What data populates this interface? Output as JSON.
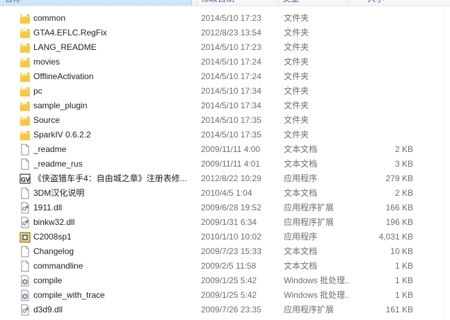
{
  "header": {
    "name": "名称",
    "date": "修改日期",
    "type": "类型",
    "size": "大小"
  },
  "files": [
    {
      "name": "common",
      "date": "2014/5/10 17:23",
      "type": "文件夹",
      "size": "",
      "icon": "folder-icon"
    },
    {
      "name": "GTA4.EFLC.RegFix",
      "date": "2012/8/23 13:54",
      "type": "文件夹",
      "size": "",
      "icon": "folder-icon"
    },
    {
      "name": "LANG_README",
      "date": "2014/5/10 17:23",
      "type": "文件夹",
      "size": "",
      "icon": "folder-icon"
    },
    {
      "name": "movies",
      "date": "2014/5/10 17:24",
      "type": "文件夹",
      "size": "",
      "icon": "folder-icon"
    },
    {
      "name": "OfflineActivation",
      "date": "2014/5/10 17:24",
      "type": "文件夹",
      "size": "",
      "icon": "folder-icon"
    },
    {
      "name": "pc",
      "date": "2014/5/10 17:34",
      "type": "文件夹",
      "size": "",
      "icon": "folder-icon"
    },
    {
      "name": "sample_plugin",
      "date": "2014/5/10 17:34",
      "type": "文件夹",
      "size": "",
      "icon": "folder-icon"
    },
    {
      "name": "Source",
      "date": "2014/5/10 17:35",
      "type": "文件夹",
      "size": "",
      "icon": "folder-icon"
    },
    {
      "name": "SparkIV 0.6.2.2",
      "date": "2014/5/10 17:35",
      "type": "文件夹",
      "size": "",
      "icon": "folder-icon"
    },
    {
      "name": "_readme",
      "date": "2009/11/11 4:00",
      "type": "文本文档",
      "size": "2 KB",
      "icon": "text-file-icon"
    },
    {
      "name": "_readme_rus",
      "date": "2009/11/11 4:01",
      "type": "文本文档",
      "size": "3 KB",
      "icon": "text-file-icon"
    },
    {
      "name": "《侠盗猎车手4：自由城之章》注册表修...",
      "date": "2012/8/22 10:29",
      "type": "应用程序",
      "size": "279 KB",
      "icon": "exe-app-icon"
    },
    {
      "name": "3DM汉化说明",
      "date": "2010/4/5 1:04",
      "type": "文本文档",
      "size": "2 KB",
      "icon": "text-file-icon"
    },
    {
      "name": "1911.dll",
      "date": "2009/6/28 19:52",
      "type": "应用程序扩展",
      "size": "166 KB",
      "icon": "dll-file-icon"
    },
    {
      "name": "binkw32.dll",
      "date": "2009/1/31 6:34",
      "type": "应用程序扩展",
      "size": "196 KB",
      "icon": "dll-file-icon"
    },
    {
      "name": "C2008sp1",
      "date": "2010/1/10 10:02",
      "type": "应用程序",
      "size": "4,031 KB",
      "icon": "installer-icon"
    },
    {
      "name": "Changelog",
      "date": "2009/7/23 15:33",
      "type": "文本文档",
      "size": "10 KB",
      "icon": "text-file-icon"
    },
    {
      "name": "commandline",
      "date": "2009/2/5 11:58",
      "type": "文本文档",
      "size": "1 KB",
      "icon": "text-file-icon"
    },
    {
      "name": "compile",
      "date": "2009/1/25 5:42",
      "type": "Windows 批处理...",
      "size": "1 KB",
      "icon": "batch-file-icon"
    },
    {
      "name": "compile_with_trace",
      "date": "2009/1/25 5:42",
      "type": "Windows 批处理...",
      "size": "1 KB",
      "icon": "batch-file-icon"
    },
    {
      "name": "d3d9.dll",
      "date": "2009/7/26 23:35",
      "type": "应用程序扩展",
      "size": "161 KB",
      "icon": "dll-file-icon"
    }
  ]
}
